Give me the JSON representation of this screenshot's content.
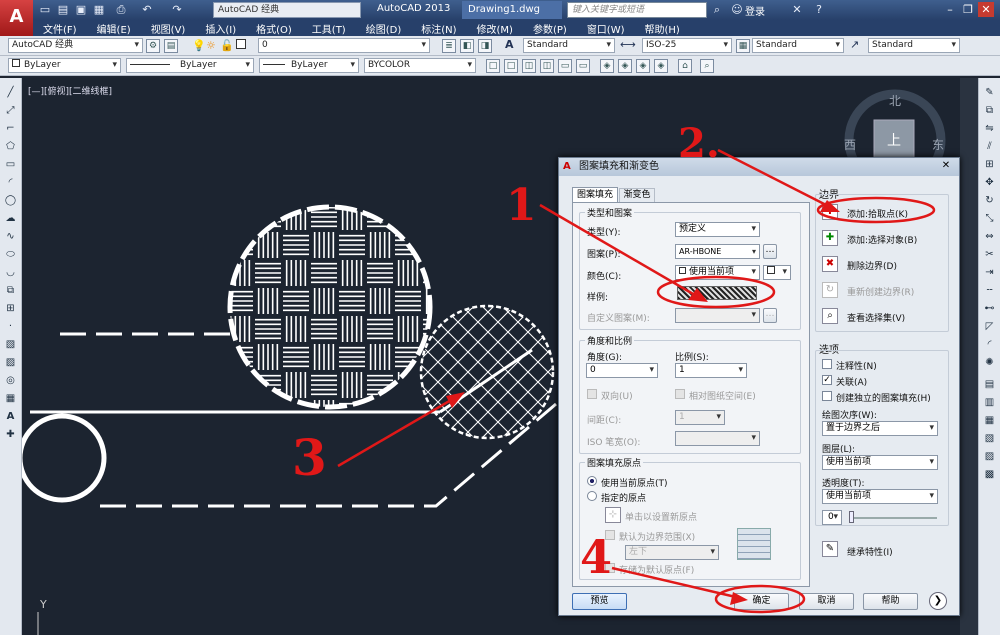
{
  "app": {
    "title": "AutoCAD 2013",
    "document": "Drawing1.dwg",
    "workspace": "AutoCAD 经典",
    "search_placeholder": "键入关键字或短语",
    "login": "登录"
  },
  "menu": [
    "文件(F)",
    "编辑(E)",
    "视图(V)",
    "插入(I)",
    "格式(O)",
    "工具(T)",
    "绘图(D)",
    "标注(N)",
    "修改(M)",
    "参数(P)",
    "窗口(W)",
    "帮助(H)"
  ],
  "toolbar1": {
    "workspace_combo": "AutoCAD 经典",
    "layer_combo": "0",
    "text_style": "Standard",
    "dim_style": "ISO-25",
    "table_style": "Standard",
    "mleader_style": "Standard"
  },
  "toolbar2": {
    "color": "ByLayer",
    "linetype": "ByLayer",
    "lineweight": "ByLayer",
    "plotstyle": "BYCOLOR"
  },
  "viewport": {
    "label": "[—][俯视][二维线框]",
    "ucs_y": "Y"
  },
  "viewcube": {
    "north": "北",
    "west": "西",
    "east": "东",
    "top": "上"
  },
  "dialog": {
    "title": "图案填充和渐变色",
    "tabs": [
      "图案填充",
      "渐变色"
    ],
    "type_group": "类型和图案",
    "type_label": "类型(Y):",
    "type_value": "预定义",
    "pattern_label": "图案(P):",
    "pattern_value": "AR-HBONE",
    "color_label": "颜色(C):",
    "color_value": "使用当前项",
    "swatch_label": "样例:",
    "custom_label": "自定义图案(M):",
    "angle_group": "角度和比例",
    "angle_label": "角度(G):",
    "angle_value": "0",
    "scale_label": "比例(S):",
    "scale_value": "1",
    "double_label": "双向(U)",
    "relative_label": "相对图纸空间(E)",
    "spacing_label": "间距(C):",
    "spacing_value": "1",
    "iso_label": "ISO 笔宽(O):",
    "origin_group": "图案填充原点",
    "origin_current": "使用当前原点(T)",
    "origin_specified": "指定的原点",
    "origin_click": "单击以设置新原点",
    "origin_default": "默认为边界范围(X)",
    "origin_position": "左下",
    "origin_store": "存储为默认原点(F)",
    "boundary_group": "边界",
    "add_pick": "添加:拾取点(K)",
    "add_select": "添加:选择对象(B)",
    "remove": "删除边界(D)",
    "recreate": "重新创建边界(R)",
    "view_sel": "查看选择集(V)",
    "options_group": "选项",
    "annotative": "注释性(N)",
    "associative": "关联(A)",
    "independent": "创建独立的图案填充(H)",
    "draw_order_label": "绘图次序(W):",
    "draw_order_value": "置于边界之后",
    "layer_label": "图层(L):",
    "layer_value": "使用当前项",
    "transparency_label": "透明度(T):",
    "transparency_value": "使用当前项",
    "transparency_num": "0",
    "inherit": "继承特性(I)",
    "preview": "预览",
    "ok": "确定",
    "cancel": "取消",
    "help": "帮助"
  },
  "annotations": {
    "n1": "1",
    "n2": "2.",
    "n3": "3",
    "n4": "4"
  },
  "colors": {
    "canvas": "#1c2430",
    "accent": "#e01818",
    "title": "#27406a"
  }
}
